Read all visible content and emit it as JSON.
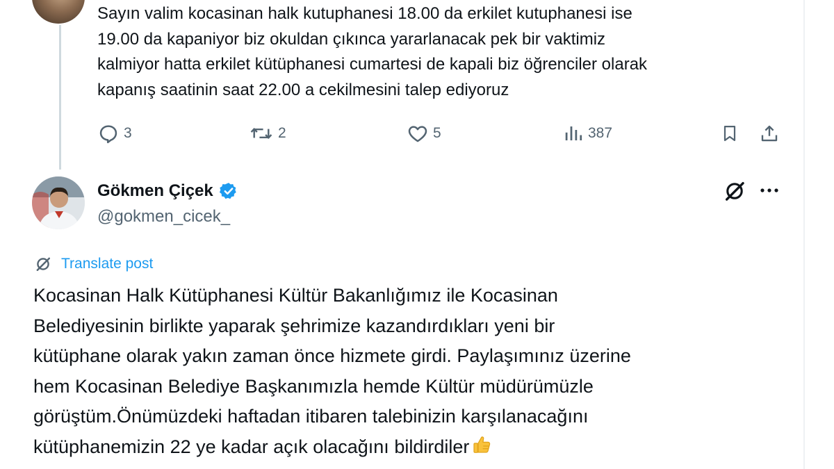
{
  "previous_tweet": {
    "text_lines": [
      "Sayın valim kocasinan halk kutuphanesi 18.00 da erkilet kutuphanesi ise",
      "19.00 da kapaniyor biz okuldan çıkınca yararlanacak pek bir vaktimiz",
      "kalmiyor hatta erkilet kütüphanesi cumartesi de kapali biz öğrenciler olarak",
      "kapanış saatinin saat 22.00 a cekilmesini talep ediyoruz"
    ],
    "actions": {
      "reply_count": "3",
      "retweet_count": "2",
      "like_count": "5",
      "view_count": "387"
    }
  },
  "reply_tweet": {
    "display_name": "Gökmen Çiçek",
    "verified": true,
    "handle": "@gokmen_cicek_",
    "translate_label": "Translate post",
    "text_lines": [
      "Kocasinan Halk Kütüphanesi Kültür Bakanlığımız ile  Kocasinan",
      "Belediyesinin birlikte yaparak şehrimize kazandırdıkları yeni bir",
      "kütüphane olarak yakın zaman önce hizmete girdi. Paylaşımınız üzerine",
      "hem Kocasinan Belediye Başkanımızla hemde Kültür müdürümüzle",
      "görüştüm.Önümüzdeki haftadan itibaren talebinizin karşılanacağını",
      "kütüphanemizin 22 ye kadar açık olacağını bildirdiler"
    ],
    "trailing_emoji": "thumbs-up-icon"
  },
  "colors": {
    "accent": "#1d9bf0",
    "text": "#0f1419",
    "muted": "#536471",
    "thread_line": "#cfd9de"
  }
}
